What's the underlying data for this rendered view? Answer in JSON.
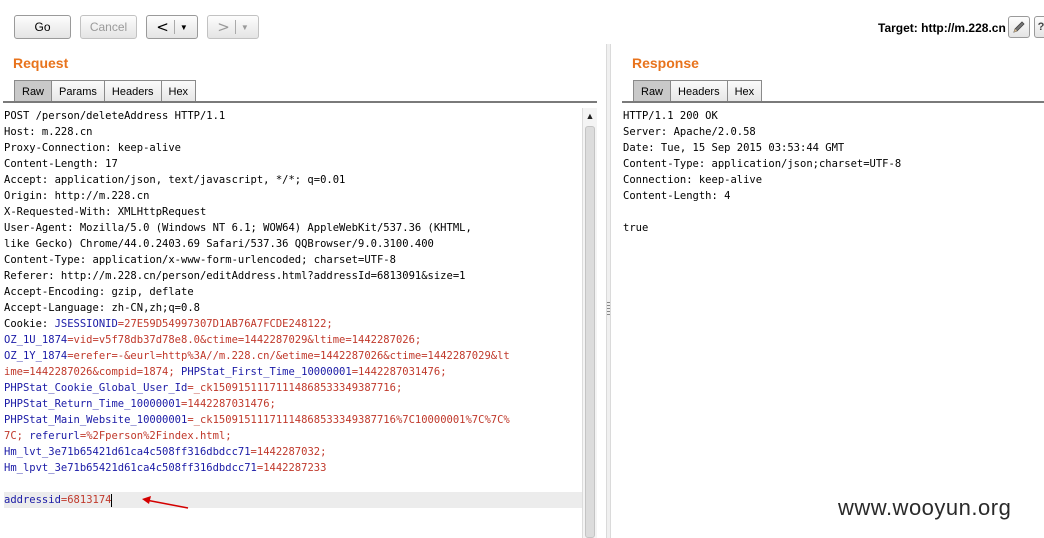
{
  "toolbar": {
    "go_label": "Go",
    "cancel_label": "Cancel",
    "back_label": "<",
    "forward_label": ">",
    "dropdown_glyph": "▼",
    "target_label": "Target: http://m.228.cn",
    "edit_icon": "pencil-icon",
    "help_icon": "question-icon"
  },
  "request": {
    "title": "Request",
    "tabs": [
      "Raw",
      "Params",
      "Headers",
      "Hex"
    ],
    "active_tab": "Raw",
    "lines": [
      [
        {
          "t": "POST /person/deleteAddress HTTP/1.1",
          "c": "n"
        }
      ],
      [
        {
          "t": "Host: m.228.cn",
          "c": "n"
        }
      ],
      [
        {
          "t": "Proxy-Connection: keep-alive",
          "c": "n"
        }
      ],
      [
        {
          "t": "Content-Length: 17",
          "c": "n"
        }
      ],
      [
        {
          "t": "Accept: application/json, text/javascript, */*; q=0.01",
          "c": "n"
        }
      ],
      [
        {
          "t": "Origin: http://m.228.cn",
          "c": "n"
        }
      ],
      [
        {
          "t": "X-Requested-With: XMLHttpRequest",
          "c": "n"
        }
      ],
      [
        {
          "t": "User-Agent: Mozilla/5.0 (Windows NT 6.1; WOW64) AppleWebKit/537.36 (KHTML,",
          "c": "n"
        }
      ],
      [
        {
          "t": "like Gecko) Chrome/44.0.2403.69 Safari/537.36 QQBrowser/9.0.3100.400",
          "c": "n"
        }
      ],
      [
        {
          "t": "Content-Type: application/x-www-form-urlencoded; charset=UTF-8",
          "c": "n"
        }
      ],
      [
        {
          "t": "Referer: http://m.228.cn/person/editAddress.html?addressId=6813091&size=1",
          "c": "n"
        }
      ],
      [
        {
          "t": "Accept-Encoding: gzip, deflate",
          "c": "n"
        }
      ],
      [
        {
          "t": "Accept-Language: zh-CN,zh;q=0.8",
          "c": "n"
        }
      ],
      [
        {
          "t": "Cookie: ",
          "c": "n"
        },
        {
          "t": "JSESSIONID",
          "c": "k"
        },
        {
          "t": "=27E59D54997307D1AB76A7FCDE248122;",
          "c": "v"
        }
      ],
      [
        {
          "t": "OZ_1U_1874",
          "c": "k"
        },
        {
          "t": "=vid=v5f78db37d78e8.0&ctime=1442287029&ltime=1442287026;",
          "c": "v"
        }
      ],
      [
        {
          "t": "OZ_1Y_1874",
          "c": "k"
        },
        {
          "t": "=erefer=-&eurl=http%3A//m.228.cn/&etime=1442287026&ctime=1442287029&lt",
          "c": "v"
        }
      ],
      [
        {
          "t": "ime=1442287026&compid=1874; ",
          "c": "v"
        },
        {
          "t": "PHPStat_First_Time_10000001",
          "c": "k"
        },
        {
          "t": "=1442287031476;",
          "c": "v"
        }
      ],
      [
        {
          "t": "PHPStat_Cookie_Global_User_Id",
          "c": "k"
        },
        {
          "t": "=_ck15091511171114868533349387716;",
          "c": "v"
        }
      ],
      [
        {
          "t": "PHPStat_Return_Time_10000001",
          "c": "k"
        },
        {
          "t": "=1442287031476;",
          "c": "v"
        }
      ],
      [
        {
          "t": "PHPStat_Main_Website_10000001",
          "c": "k"
        },
        {
          "t": "=_ck15091511171114868533349387716%7C10000001%7C%7C%",
          "c": "v"
        }
      ],
      [
        {
          "t": "7C; ",
          "c": "v"
        },
        {
          "t": "referurl",
          "c": "k"
        },
        {
          "t": "=%2Fperson%2Findex.html;",
          "c": "v"
        }
      ],
      [
        {
          "t": "Hm_lvt_3e71b65421d61ca4c508ff316dbdcc71",
          "c": "k"
        },
        {
          "t": "=1442287032;",
          "c": "v"
        }
      ],
      [
        {
          "t": "Hm_lpvt_3e71b65421d61ca4c508ff316dbdcc71",
          "c": "k"
        },
        {
          "t": "=1442287233",
          "c": "v"
        }
      ],
      [
        {
          "t": "",
          "c": "n"
        }
      ],
      [
        {
          "t": "addressid",
          "c": "k"
        },
        {
          "t": "=6813174",
          "c": "v"
        }
      ]
    ]
  },
  "response": {
    "title": "Response",
    "tabs": [
      "Raw",
      "Headers",
      "Hex"
    ],
    "active_tab": "Raw",
    "lines": [
      "HTTP/1.1 200 OK",
      "Server: Apache/2.0.58",
      "Date: Tue, 15 Sep 2015 03:53:44 GMT",
      "Content-Type: application/json;charset=UTF-8",
      "Connection: keep-alive",
      "Content-Length: 4",
      "",
      "true"
    ]
  },
  "watermark": "www.wooyun.org",
  "colors": {
    "accent": "#e8731c",
    "param_name": "#1a1aa6",
    "param_value": "#c0392b",
    "annotation_arrow": "#d40000"
  }
}
